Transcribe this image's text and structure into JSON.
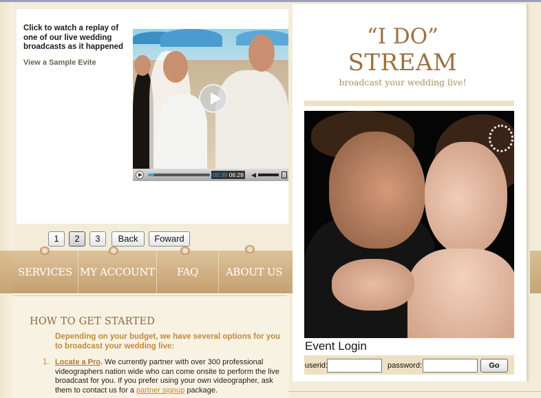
{
  "video_panel": {
    "caption": "Click to watch a replay of one of our live wedding broadcasts as it happened",
    "sample_link": "View a Sample Evite",
    "player": {
      "elapsed": "00:39",
      "duration": "06:28",
      "progress": 0.1,
      "icons": [
        "play-icon",
        "volume-icon",
        "fullscreen-icon"
      ]
    }
  },
  "pager": {
    "pages": [
      "1",
      "2",
      "3"
    ],
    "active": "2",
    "back_label": "Back",
    "forward_label": "Foward"
  },
  "nav": {
    "items": [
      {
        "label": "SERVICES"
      },
      {
        "label": "MY ACCOUNT"
      },
      {
        "label": "FAQ"
      },
      {
        "label": "ABOUT US"
      }
    ]
  },
  "content": {
    "title": "HOW TO GET STARTED",
    "intro": "Depending on your budget, we have several options for you to broadcast your wedding live:",
    "list": [
      {
        "number": "1.",
        "link": "Locate a Pro",
        "text_before": ". We currently partner with over 300 professional videographers nation wide who can come onsite to perform the live broadcast for you. If you prefer using your own videographer, ask them to contact us for a ",
        "inline_link": "partner signup",
        "text_after": " package."
      }
    ]
  },
  "brand": {
    "logo_top": "“I DO”",
    "logo_main": "STREAM",
    "tagline": "broadcast your wedding live!",
    "color": "#9c7040"
  },
  "login": {
    "title": "Event Login",
    "userid_label": "userid:",
    "userid_value": "",
    "password_label": "password:",
    "password_value": "",
    "go_label": "Go"
  },
  "colors": {
    "background": "#f3ecd9",
    "nav": "#c6a474",
    "accent": "#c08a3c"
  }
}
